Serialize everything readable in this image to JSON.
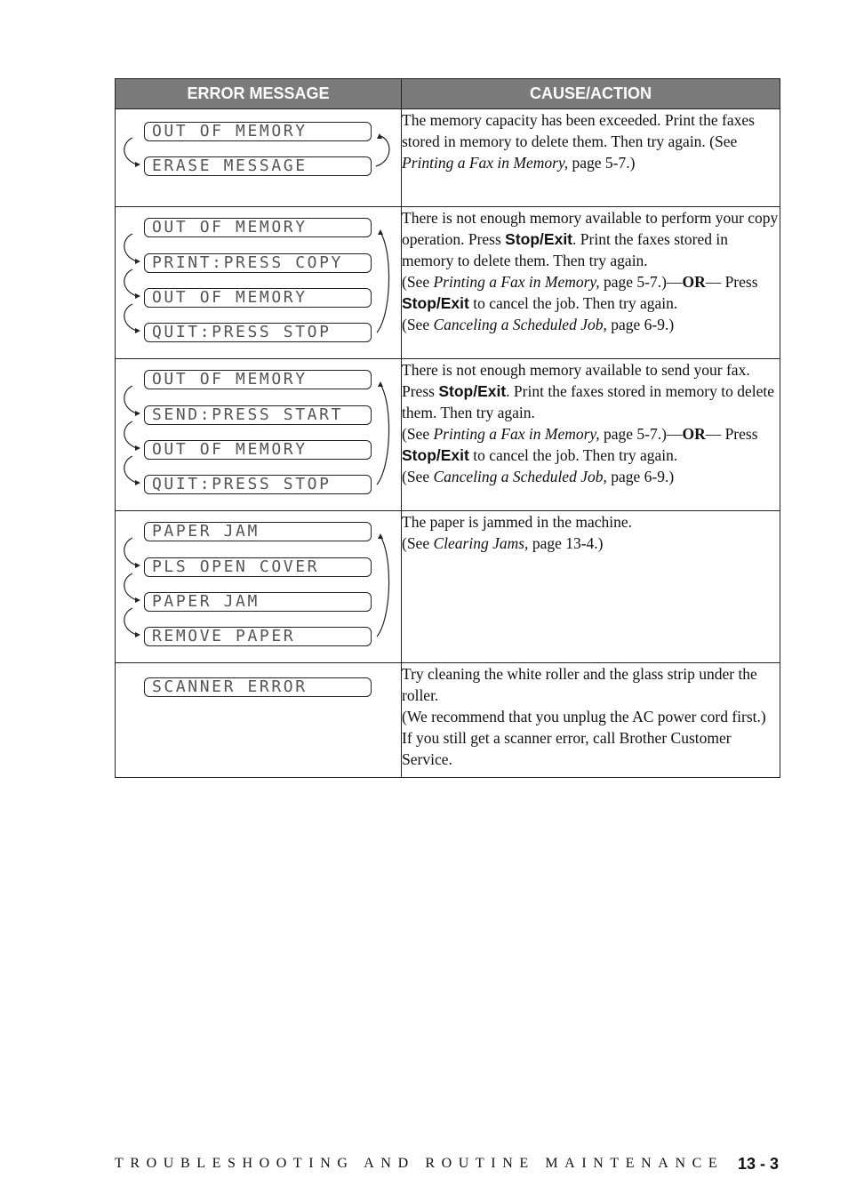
{
  "table": {
    "headers": [
      "ERROR MESSAGE",
      "CAUSE/ACTION"
    ],
    "rows": [
      {
        "lcd": [
          "OUT OF MEMORY",
          "ERASE MESSAGE"
        ],
        "cause": [
          {
            "t": "The memory capacity has been exceeded. Print the faxes stored in memory to delete them. Then try again. (See "
          },
          {
            "t": "Printing a Fax in Memory,",
            "s": "it"
          },
          {
            "t": " page 5-7.)"
          }
        ]
      },
      {
        "lcd": [
          "OUT OF MEMORY",
          "PRINT:PRESS COPY",
          "OUT OF MEMORY",
          "QUIT:PRESS STOP"
        ],
        "cause": [
          {
            "t": "There is not enough memory available to perform your copy operation. Press "
          },
          {
            "t": "Stop/Exit",
            "s": "b"
          },
          {
            "t": ". Print the faxes stored in memory to delete them. Then try again."
          },
          {
            "br": true
          },
          {
            "t": "(See "
          },
          {
            "t": "Printing a Fax in Memory,",
            "s": "it"
          },
          {
            "t": " page 5-7.)—"
          },
          {
            "t": "OR",
            "s": "bs"
          },
          {
            "t": "— Press "
          },
          {
            "t": "Stop/Exit",
            "s": "b"
          },
          {
            "t": " to cancel the job. Then try again."
          },
          {
            "br": true
          },
          {
            "t": "(See "
          },
          {
            "t": "Canceling a Scheduled Job,",
            "s": "it"
          },
          {
            "t": " page 6-9.)"
          }
        ]
      },
      {
        "lcd": [
          "OUT OF MEMORY",
          "SEND:PRESS START",
          "OUT OF MEMORY",
          "QUIT:PRESS STOP"
        ],
        "cause": [
          {
            "t": "There is not enough memory available to send your fax. Press "
          },
          {
            "t": "Stop/Exit",
            "s": "b"
          },
          {
            "t": ". Print the faxes stored in memory to delete them. Then try again."
          },
          {
            "br": true
          },
          {
            "t": "(See "
          },
          {
            "t": "Printing a Fax in Memory,",
            "s": "it"
          },
          {
            "t": " page 5-7.)—"
          },
          {
            "t": "OR",
            "s": "bs"
          },
          {
            "t": "— Press "
          },
          {
            "t": "Stop/Exit",
            "s": "b"
          },
          {
            "t": " to cancel the job. Then try again."
          },
          {
            "br": true
          },
          {
            "t": "(See "
          },
          {
            "t": "Canceling a Scheduled Job,",
            "s": "it"
          },
          {
            "t": " page 6-9.)"
          }
        ]
      },
      {
        "lcd": [
          "PAPER JAM",
          "PLS OPEN COVER",
          "PAPER JAM",
          "REMOVE PAPER"
        ],
        "cause": [
          {
            "t": "The paper is jammed in the machine."
          },
          {
            "br": true
          },
          {
            "t": "(See "
          },
          {
            "t": "Clearing Jams,",
            "s": "it"
          },
          {
            "t": " page 13-4.)"
          }
        ]
      },
      {
        "lcd": [
          "SCANNER ERROR"
        ],
        "cause": [
          {
            "t": "Try cleaning the white roller and the glass strip under the roller."
          },
          {
            "br": true
          },
          {
            "t": "(We recommend that you unplug the AC power cord first.) If you still get a scanner error, call Brother Customer Service."
          }
        ]
      }
    ]
  },
  "footer": {
    "section": "TROUBLESHOOTING AND ROUTINE MAINTENANCE",
    "page": "13 - 3"
  }
}
